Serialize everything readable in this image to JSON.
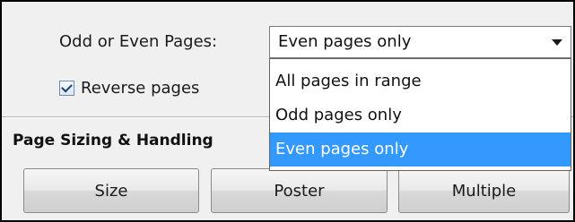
{
  "odd_even": {
    "label": "Odd or Even Pages:",
    "selected_value": "Even pages only",
    "options": [
      {
        "label": "All pages in range",
        "selected": false
      },
      {
        "label": "Odd pages only",
        "selected": false
      },
      {
        "label": "Even pages only",
        "selected": true
      }
    ]
  },
  "reverse_pages": {
    "label": "Reverse pages",
    "checked": true
  },
  "page_sizing": {
    "title": "Page Sizing & Handling",
    "buttons": [
      {
        "label": "Size"
      },
      {
        "label": "Poster"
      },
      {
        "label": "Multiple"
      }
    ]
  },
  "colors": {
    "highlight": "#3399ff",
    "panel_background": "#f0f0f0"
  },
  "icons": {
    "dropdown_arrow": "chevron-down-icon",
    "checkbox_check": "checkmark-icon"
  }
}
